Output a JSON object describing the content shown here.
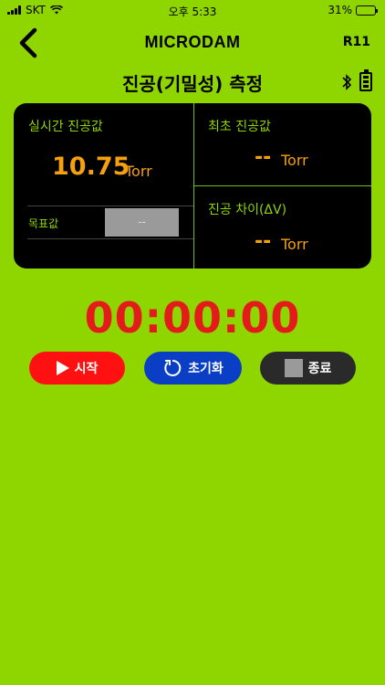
{
  "status_bar": {
    "carrier": "SKT",
    "time": "오후 5:33",
    "battery": "31%"
  },
  "header": {
    "brand": "MICRODAM",
    "model": "R11",
    "title": "진공(기밀성) 측정"
  },
  "panel": {
    "realtime_label": "실시간 진공값",
    "realtime_value": "10.75",
    "realtime_unit": "Torr",
    "target_label": "목표값",
    "target_value": "--",
    "initial_label": "최초 진공값",
    "initial_value": "--",
    "initial_unit": "Torr",
    "diff_label": "진공 차이(ΔV)",
    "diff_value": "--",
    "diff_unit": "Torr"
  },
  "timer": "00:00:00",
  "buttons": {
    "start": "시작",
    "reset": "초기화",
    "stop": "종료"
  },
  "colors": {
    "background": "#8fd500",
    "accent_value": "#f5a00d",
    "timer": "#e41b1b",
    "start": "#ff1111",
    "reset": "#0a3ec4",
    "stop": "#2a2a2a"
  }
}
